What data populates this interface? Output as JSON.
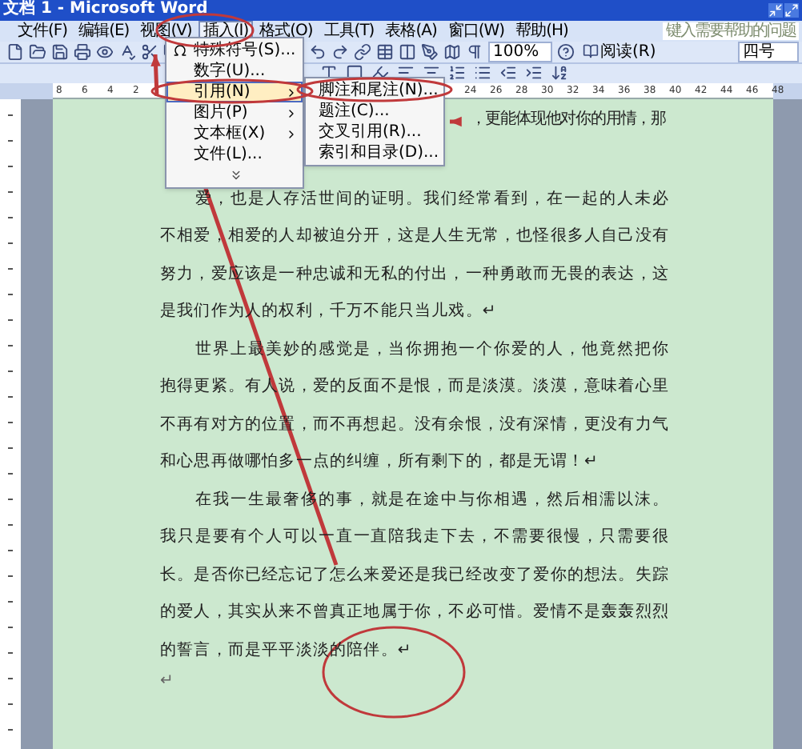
{
  "window": {
    "title": "文档 1 - Microsoft Word"
  },
  "menu_bar": [
    {
      "label": "文件(F)",
      "selected": false
    },
    {
      "label": "编辑(E)",
      "selected": false
    },
    {
      "label": "视图(V)",
      "selected": false
    },
    {
      "label": "插入(I)",
      "selected": true
    },
    {
      "label": "格式(O)",
      "selected": false
    },
    {
      "label": "工具(T)",
      "selected": false
    },
    {
      "label": "表格(A)",
      "selected": false
    },
    {
      "label": "窗口(W)",
      "selected": false
    },
    {
      "label": "帮助(H)",
      "selected": false
    }
  ],
  "help_box": {
    "placeholder": "键入需要帮助的问题"
  },
  "toolbar": {
    "zoom": "100%",
    "read_button": "阅读(R)",
    "font_size": "四号"
  },
  "ruler": {
    "left_numbers": [
      "8",
      "6",
      "4",
      "2"
    ],
    "right_numbers": [
      "24",
      "26",
      "28",
      "30",
      "32",
      "34",
      "36",
      "38",
      "40",
      "42",
      "44",
      "46",
      "48"
    ]
  },
  "insert_menu": [
    {
      "label": "特殊符号(S)...",
      "kind": "command",
      "selected": false
    },
    {
      "label": "数字(U)...",
      "kind": "command",
      "selected": false
    },
    {
      "label": "引用(N)",
      "kind": "submenu",
      "selected": true
    },
    {
      "label": "图片(P)",
      "kind": "submenu",
      "selected": false
    },
    {
      "label": "文本框(X)",
      "kind": "submenu",
      "selected": false
    },
    {
      "label": "文件(L)...",
      "kind": "command",
      "selected": false
    },
    {
      "kind": "expand",
      "selected": false
    }
  ],
  "reference_submenu": [
    {
      "label": "脚注和尾注(N)..."
    },
    {
      "label": "题注(C)..."
    },
    {
      "label": "交叉引用(R)..."
    },
    {
      "label": "索引和目录(D)..."
    }
  ],
  "document": {
    "paragraphs": [
      {
        "kind": "partial",
        "text": "，更能体现他对你的用情，那"
      },
      {
        "kind": "body",
        "text": "爱，也是人存活世间的证明。我们经常看到，在一起的人未必不相爱，相爱的人却被迫分开，这是人生无常，也怪很多人自己没有努力，爱应该是一种忠诚和无私的付出，一种勇敢而无畏的表达，这是我们作为人的权利，千万不能只当儿戏。↵"
      },
      {
        "kind": "body",
        "text": "世界上最美妙的感觉是，当你拥抱一个你爱的人，他竟然把你抱得更紧。有人说，爱的反面不是恨，而是淡漠。淡漠，意味着心里不再有对方的位置，而不再想起。没有余恨，没有深情，更没有力气和心思再做哪怕多一点的纠缠，所有剩下的，都是无谓！↵"
      },
      {
        "kind": "body",
        "text": "在我一生最奢侈的事，就是在途中与你相遇，然后相濡以沫。我只是要有个人可以一直一直陪我走下去，不需要很慢，只需要很长。是否你已经忘记了怎么来爱还是我已经改变了爱你的想法。失踪的爱人，其实从来不曾真正地属于你，不必可惜。爱情不是轰轰烈烈的誓言，而是平平淡淡的陪伴。↵"
      },
      {
        "kind": "empty",
        "text": "↵"
      }
    ]
  }
}
